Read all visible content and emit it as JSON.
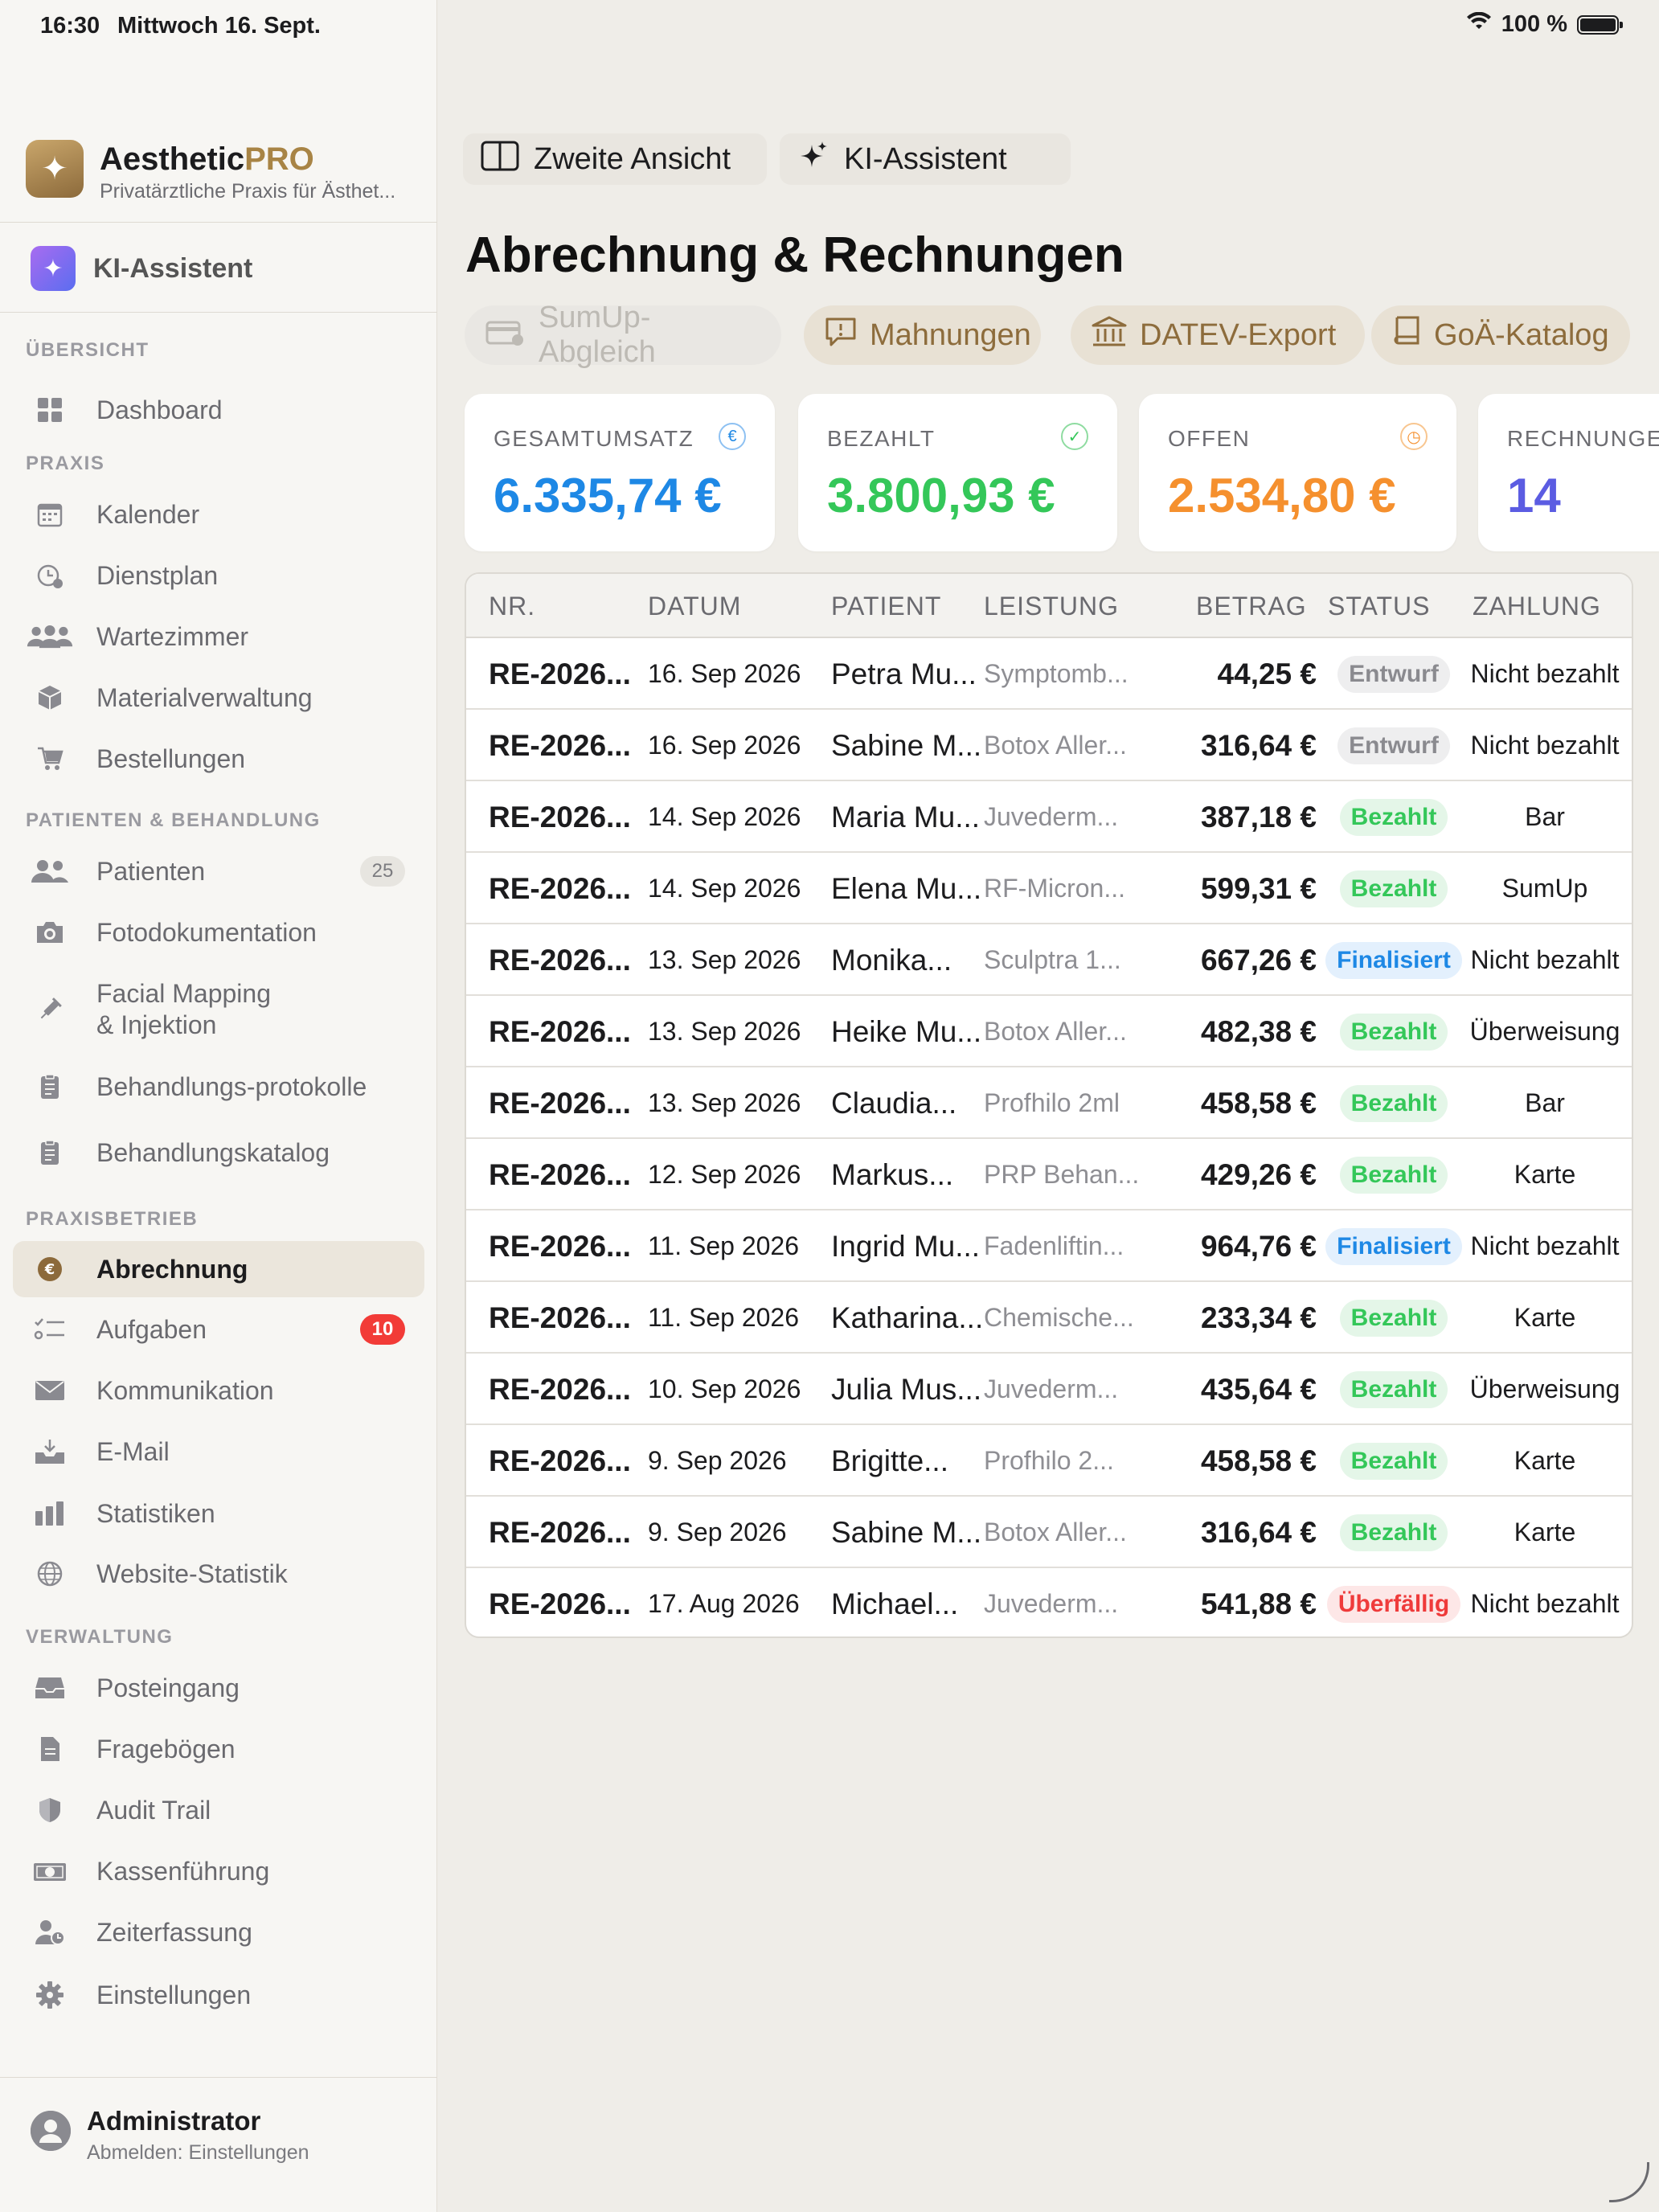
{
  "status_bar": {
    "time": "16:30",
    "date": "Mittwoch 16. Sept.",
    "battery": "100 %"
  },
  "sidebar": {
    "brand_name": "Aesthetic",
    "brand_suffix": "PRO",
    "brand_sub": "Privatärztliche Praxis für Ästhet...",
    "ki_label": "KI-Assistent",
    "sections": {
      "overview": "ÜBERSICHT",
      "praxis": "PRAXIS",
      "patients": "PATIENTEN & BEHANDLUNG",
      "business": "PRAXISBETRIEB",
      "admin": "VERWALTUNG"
    },
    "items": {
      "dashboard": "Dashboard",
      "kalender": "Kalender",
      "dienstplan": "Dienstplan",
      "wartezimmer": "Wartezimmer",
      "material": "Materialverwaltung",
      "bestellungen": "Bestellungen",
      "patienten": "Patienten",
      "patienten_count": "25",
      "foto": "Fotodokumentation",
      "facial_line1": "Facial Mapping",
      "facial_line2": "& Injektion",
      "protokolle": "Behandlungs-protokolle",
      "katalog": "Behandlungskatalog",
      "abrechnung": "Abrechnung",
      "aufgaben": "Aufgaben",
      "aufgaben_count": "10",
      "kommunikation": "Kommunikation",
      "email": "E-Mail",
      "statistiken": "Statistiken",
      "website": "Website-Statistik",
      "posteingang": "Posteingang",
      "frageboegen": "Fragebögen",
      "audit": "Audit Trail",
      "kasse": "Kassenführung",
      "zeit": "Zeiterfassung",
      "einstellungen": "Einstellungen"
    },
    "user": {
      "name": "Administrator",
      "sub": "Abmelden: Einstellungen"
    }
  },
  "main": {
    "top_buttons": {
      "second_view": "Zweite Ansicht",
      "ki": "KI-Assistent"
    },
    "title": "Abrechnung & Rechnungen",
    "tools": {
      "sumup": "SumUp-Abgleich",
      "mahnungen": "Mahnungen",
      "datev": "DATEV-Export",
      "goae": "GoÄ-Katalog"
    },
    "cards": {
      "gesamt_label": "GESAMTUMSATZ",
      "gesamt_value": "6.335,74 €",
      "bezahlt_label": "BEZAHLT",
      "bezahlt_value": "3.800,93 €",
      "offen_label": "OFFEN",
      "offen_value": "2.534,80 €",
      "rechnungen_label": "RECHNUNGEN",
      "rechnungen_value": "14"
    },
    "colors": {
      "blue": "#1e88e5",
      "green": "#34c759",
      "orange": "#f5902e",
      "purple": "#5b5ce2",
      "accent": "#a88445"
    },
    "table": {
      "headers": {
        "nr": "NR.",
        "datum": "DATUM",
        "patient": "PATIENT",
        "leistung": "LEISTUNG",
        "betrag": "BETRAG",
        "status": "STATUS",
        "zahlung": "ZAHLUNG"
      },
      "rows": [
        {
          "nr": "RE-2026...",
          "datum": "16. Sep 2026",
          "patient": "Petra Mu...",
          "leistung": "Symptomb...",
          "betrag": "44,25 €",
          "status": "Entwurf",
          "zahlung": "Nicht bezahlt"
        },
        {
          "nr": "RE-2026...",
          "datum": "16. Sep 2026",
          "patient": "Sabine M...",
          "leistung": "Botox Aller...",
          "betrag": "316,64 €",
          "status": "Entwurf",
          "zahlung": "Nicht bezahlt"
        },
        {
          "nr": "RE-2026...",
          "datum": "14. Sep 2026",
          "patient": "Maria Mu...",
          "leistung": "Juvederm...",
          "betrag": "387,18 €",
          "status": "Bezahlt",
          "zahlung": "Bar"
        },
        {
          "nr": "RE-2026...",
          "datum": "14. Sep 2026",
          "patient": "Elena Mu...",
          "leistung": "RF-Micron...",
          "betrag": "599,31 €",
          "status": "Bezahlt",
          "zahlung": "SumUp"
        },
        {
          "nr": "RE-2026...",
          "datum": "13. Sep 2026",
          "patient": "Monika...",
          "leistung": "Sculptra 1...",
          "betrag": "667,26 €",
          "status": "Finalisiert",
          "zahlung": "Nicht bezahlt"
        },
        {
          "nr": "RE-2026...",
          "datum": "13. Sep 2026",
          "patient": "Heike Mu...",
          "leistung": "Botox Aller...",
          "betrag": "482,38 €",
          "status": "Bezahlt",
          "zahlung": "Überweisung"
        },
        {
          "nr": "RE-2026...",
          "datum": "13. Sep 2026",
          "patient": "Claudia...",
          "leistung": "Profhilo 2ml",
          "betrag": "458,58 €",
          "status": "Bezahlt",
          "zahlung": "Bar"
        },
        {
          "nr": "RE-2026...",
          "datum": "12. Sep 2026",
          "patient": "Markus...",
          "leistung": "PRP Behan...",
          "betrag": "429,26 €",
          "status": "Bezahlt",
          "zahlung": "Karte"
        },
        {
          "nr": "RE-2026...",
          "datum": "11. Sep 2026",
          "patient": "Ingrid Mu...",
          "leistung": "Fadenliftin...",
          "betrag": "964,76 €",
          "status": "Finalisiert",
          "zahlung": "Nicht bezahlt"
        },
        {
          "nr": "RE-2026...",
          "datum": "11. Sep 2026",
          "patient": "Katharina...",
          "leistung": "Chemische...",
          "betrag": "233,34 €",
          "status": "Bezahlt",
          "zahlung": "Karte"
        },
        {
          "nr": "RE-2026...",
          "datum": "10. Sep 2026",
          "patient": "Julia Mus...",
          "leistung": "Juvederm...",
          "betrag": "435,64 €",
          "status": "Bezahlt",
          "zahlung": "Überweisung"
        },
        {
          "nr": "RE-2026...",
          "datum": "9. Sep 2026",
          "patient": "Brigitte...",
          "leistung": "Profhilo 2...",
          "betrag": "458,58 €",
          "status": "Bezahlt",
          "zahlung": "Karte"
        },
        {
          "nr": "RE-2026...",
          "datum": "9. Sep 2026",
          "patient": "Sabine M...",
          "leistung": "Botox Aller...",
          "betrag": "316,64 €",
          "status": "Bezahlt",
          "zahlung": "Karte"
        },
        {
          "nr": "RE-2026...",
          "datum": "17. Aug 2026",
          "patient": "Michael...",
          "leistung": "Juvederm...",
          "betrag": "541,88 €",
          "status": "Überfällig",
          "zahlung": "Nicht bezahlt"
        }
      ]
    }
  }
}
